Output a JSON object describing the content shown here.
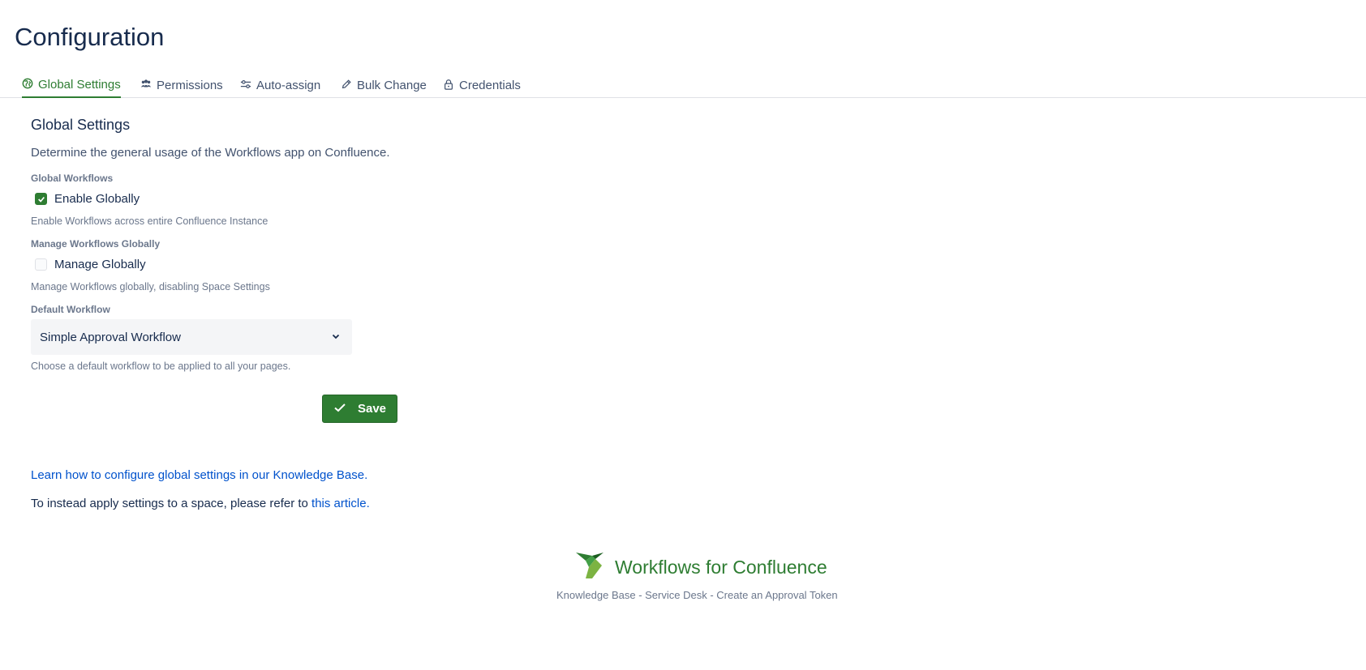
{
  "page": {
    "title": "Configuration"
  },
  "tabs": [
    {
      "label": "Global Settings",
      "icon": "globe-icon",
      "active": true
    },
    {
      "label": "Permissions",
      "icon": "users-icon",
      "active": false
    },
    {
      "label": "Auto-assign",
      "icon": "sliders-icon",
      "active": false
    },
    {
      "label": "Bulk Change",
      "icon": "pencil-icon",
      "active": false
    },
    {
      "label": "Credentials",
      "icon": "lock-icon",
      "active": false
    }
  ],
  "global_settings": {
    "title": "Global Settings",
    "description": "Determine the general usage of the Workflows app on Confluence.",
    "global_workflows": {
      "label": "Global Workflows",
      "checkbox_label": "Enable Globally",
      "checked": true,
      "helper": "Enable Workflows across entire Confluence Instance"
    },
    "manage_globally": {
      "label": "Manage Workflows Globally",
      "checkbox_label": "Manage Globally",
      "checked": false,
      "helper": "Manage Workflows globally, disabling Space Settings"
    },
    "default_workflow": {
      "label": "Default Workflow",
      "selected": "Simple Approval Workflow",
      "helper": "Choose a default workflow to be applied to all your pages."
    },
    "save_label": "Save"
  },
  "links": {
    "knowledge_base_link": "Learn how to configure global settings in our Knowledge Base.",
    "space_text": "To instead apply settings to a space, please refer to ",
    "space_link": "this article",
    "space_suffix": "."
  },
  "footer": {
    "brand": "Workflows for Confluence",
    "links": [
      "Knowledge Base",
      "Service Desk",
      "Create an Approval Token"
    ],
    "separator": " - "
  },
  "colors": {
    "accent": "#2e7d32",
    "link": "#0052cc",
    "text": "#172b4d",
    "muted": "#6b778c"
  }
}
